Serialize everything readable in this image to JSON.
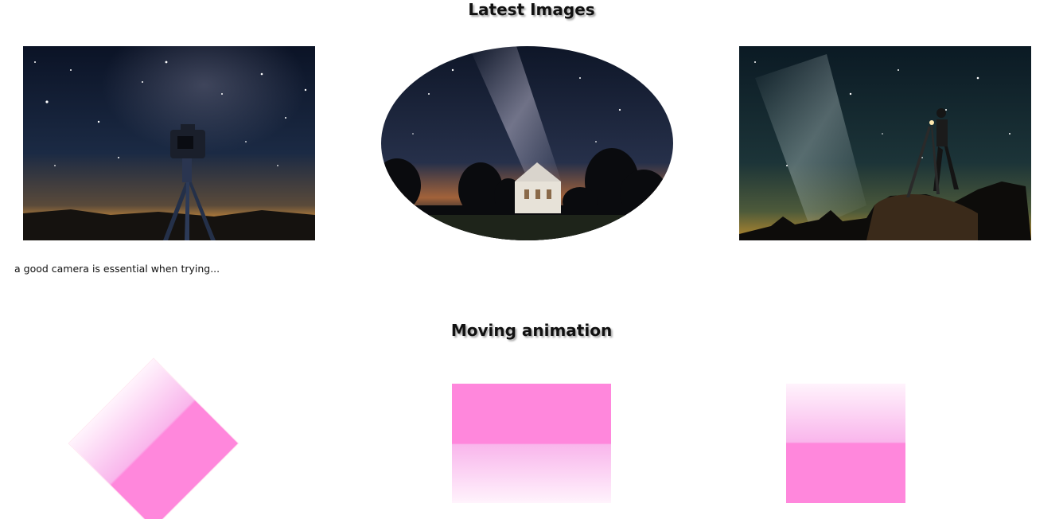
{
  "sections": {
    "latest_images_title": "Latest Images",
    "moving_animation_title": "Moving animation"
  },
  "gallery": {
    "photos": [
      {
        "subject": "camera-on-tripod-under-milky-way"
      },
      {
        "subject": "white-chapel-under-milky-way"
      },
      {
        "subject": "photographer-on-rock-with-tripod-under-milky-way"
      }
    ],
    "caption": "a good camera is essential when trying..."
  },
  "animation": {
    "shapes": [
      "diamond",
      "rectangle",
      "square"
    ],
    "colors": {
      "pink": "#ff87dc",
      "light_pink": "#fff3fc"
    }
  }
}
